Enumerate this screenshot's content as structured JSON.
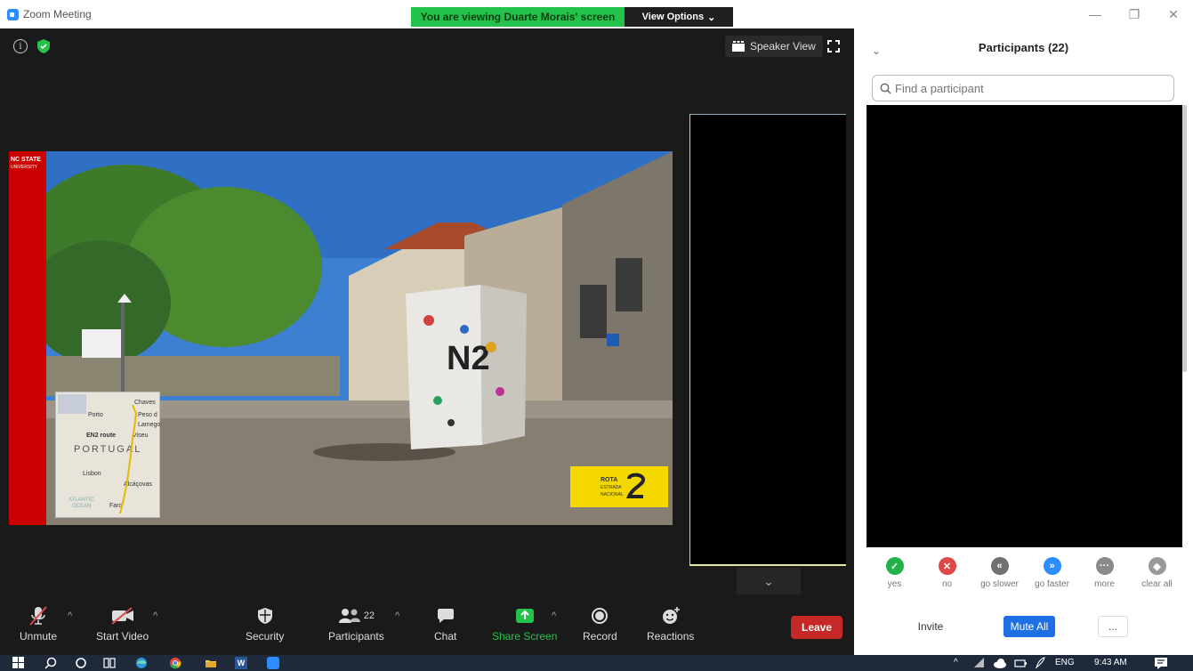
{
  "window": {
    "title": "Zoom Meeting",
    "share_banner": "You are viewing Duarte Morais' screen",
    "view_options": "View Options",
    "minimize": "—",
    "restore": "❐",
    "close": "✕"
  },
  "stage": {
    "info": "i",
    "speaker_view": "Speaker View"
  },
  "slide": {
    "logo_line1": "NC STATE",
    "logo_line2": "UNIVERSITY",
    "map_labels": {
      "chaves": "Chaves",
      "porto": "Porto",
      "peso": "Peso d",
      "lamego": "Lamego",
      "en2route": "EN2 route",
      "viseu": "Viseu",
      "portugal": "PORTUGAL",
      "lisbon": "Lisbon",
      "alcacovas": "Alcáçovas",
      "atlantic": "ATLANTIC",
      "ocean": "OCEAN",
      "faro": "Faro"
    },
    "rota_line1": "ROTA",
    "rota_line2": "ESTRADA",
    "rota_line3": "NACIONAL",
    "marker_text": "N2"
  },
  "toolbar": {
    "unmute": "Unmute",
    "start_video": "Start Video",
    "security": "Security",
    "participants": "Participants",
    "participants_count": "22",
    "chat": "Chat",
    "share_screen": "Share Screen",
    "record": "Record",
    "reactions": "Reactions",
    "leave": "Leave"
  },
  "panel": {
    "title": "Participants (22)",
    "search_placeholder": "Find a participant",
    "feedback": [
      {
        "label": "yes",
        "symbol": "✓",
        "color": "#23b24a"
      },
      {
        "label": "no",
        "symbol": "✕",
        "color": "#e04848"
      },
      {
        "label": "go slower",
        "symbol": "«",
        "color": "#707070"
      },
      {
        "label": "go faster",
        "symbol": "»",
        "color": "#2d8cff"
      },
      {
        "label": "more",
        "symbol": "···",
        "color": "#8a8a8a"
      },
      {
        "label": "clear all",
        "symbol": "◆",
        "color": "#999999"
      }
    ],
    "invite": "Invite",
    "mute_all": "Mute All",
    "more": "..."
  },
  "taskbar": {
    "lang": "ENG",
    "time": "9:43 AM",
    "word": "W"
  },
  "colors": {
    "zoom_blue": "#2d8cff",
    "share_green": "#23c24a",
    "leave_red": "#c62828",
    "ncstate_red": "#cc0000",
    "rota_yellow": "#f5d700"
  }
}
